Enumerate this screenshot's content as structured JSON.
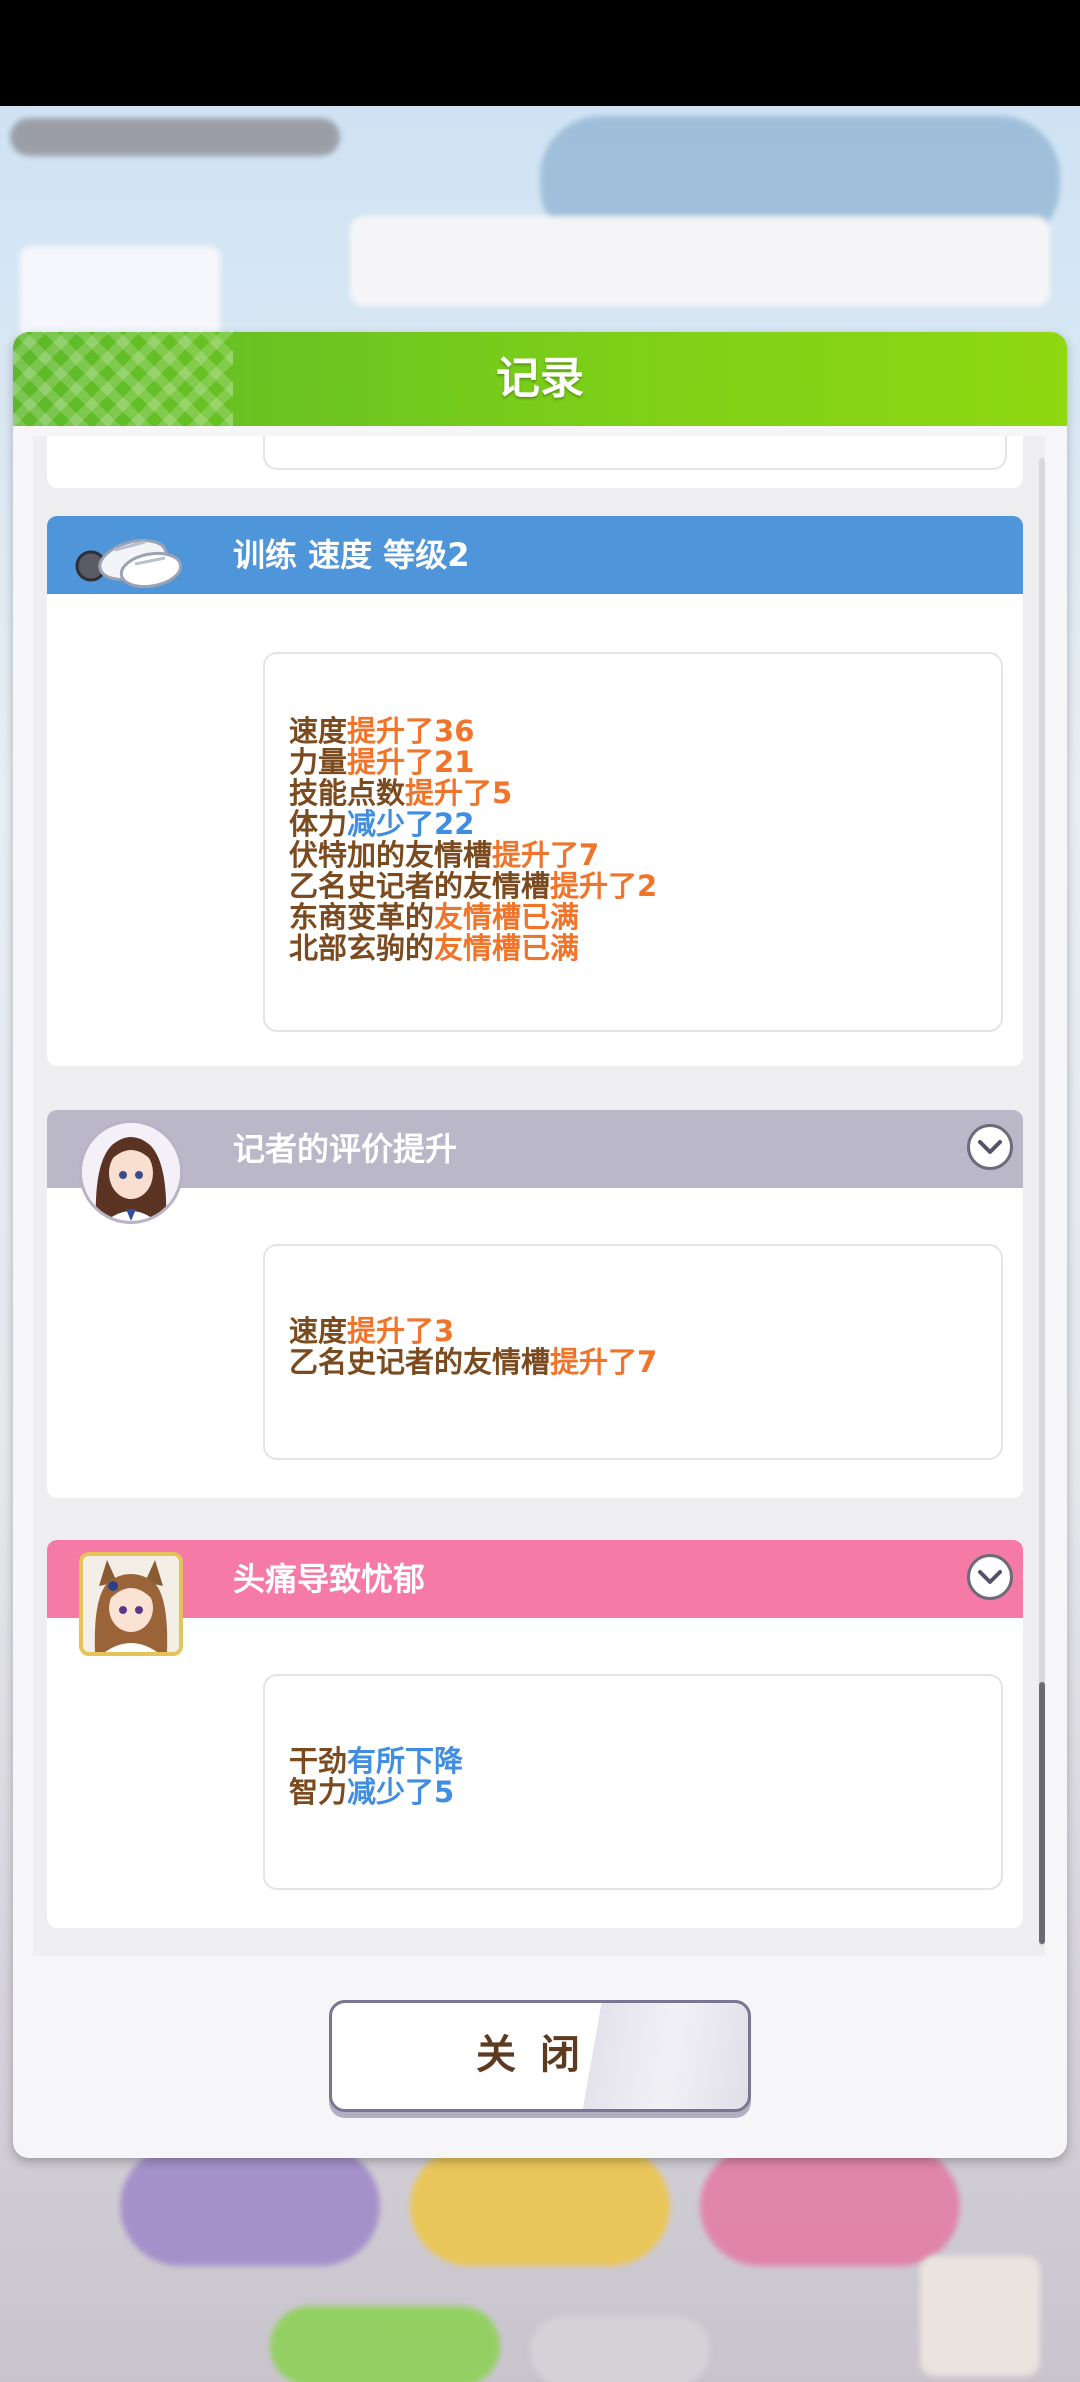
{
  "dialog": {
    "title": "记录",
    "close_label": "关闭"
  },
  "entries": [
    {
      "title": "训练 速度 等级2",
      "header_color": "#4f95d9",
      "icon": "training-shoes-icon",
      "lines": [
        {
          "label": "速度",
          "change": "提升了36",
          "dir": "up"
        },
        {
          "label": "力量",
          "change": "提升了21",
          "dir": "up"
        },
        {
          "label": "技能点数",
          "change": "提升了5",
          "dir": "up"
        },
        {
          "label": "体力",
          "change": "减少了22",
          "dir": "down"
        },
        {
          "label": "伏特加的友情槽",
          "change": "提升了7",
          "dir": "up"
        },
        {
          "label": "乙名史记者的友情槽",
          "change": "提升了2",
          "dir": "up"
        },
        {
          "label": "东商变革的",
          "change": "友情槽已满",
          "dir": "up"
        },
        {
          "label": "北部玄驹的",
          "change": "友情槽已满",
          "dir": "up"
        }
      ]
    },
    {
      "title": "记者的评价提升",
      "header_color": "#b9b7c8",
      "icon": "reporter-avatar",
      "lines": [
        {
          "label": "速度",
          "change": "提升了3",
          "dir": "up"
        },
        {
          "label": "乙名史记者的友情槽",
          "change": "提升了7",
          "dir": "up"
        }
      ]
    },
    {
      "title": "头痛导致忧郁",
      "header_color": "#f57ba6",
      "icon": "horse-girl-avatar",
      "lines": [
        {
          "label": "干劲",
          "change": "有所下降",
          "dir": "down"
        },
        {
          "label": "智力",
          "change": "减少了5",
          "dir": "down"
        }
      ]
    }
  ],
  "colors": {
    "header_green": "#7ccf18",
    "label_brown": "#7b4a1e",
    "increase_orange": "#f0752b",
    "decrease_blue": "#3f8ee0"
  }
}
